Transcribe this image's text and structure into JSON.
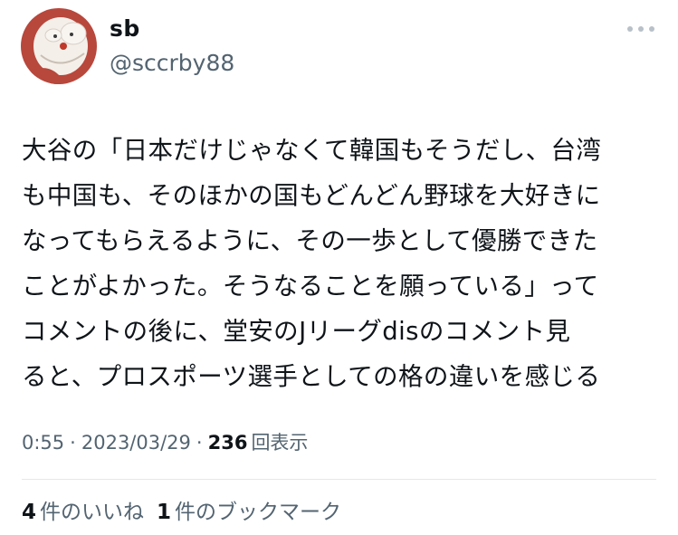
{
  "user": {
    "display_name": "sb",
    "handle": "@sccrby88",
    "avatar_icon": "avatar-icon"
  },
  "more_icon": "more-horizontal-icon",
  "tweet": {
    "lines": [
      "大谷の「日本だけじゃなくて韓国もそうだし、台湾",
      "も中国も、そのほかの国もどんどん野球を大好きに",
      "なってもらえるように、その一歩として優勝できた",
      "ことがよかった。そうなることを願っている」って",
      "コメントの後に、堂安のJリーグdisのコメント見",
      "ると、プロスポーツ選手としての格の違いを感じる"
    ]
  },
  "meta": {
    "time": "0:55",
    "separator": "·",
    "date": "2023/03/29",
    "views_count": "236",
    "views_label": "回表示"
  },
  "stats": {
    "likes_count": "4",
    "likes_label": "件のいいね",
    "bookmarks_count": "1",
    "bookmarks_label": "件のブックマーク"
  },
  "colors": {
    "text": "#0f1419",
    "secondary": "#536471",
    "divider": "#e5e8eb",
    "avatar_bg": "#b8473c"
  }
}
